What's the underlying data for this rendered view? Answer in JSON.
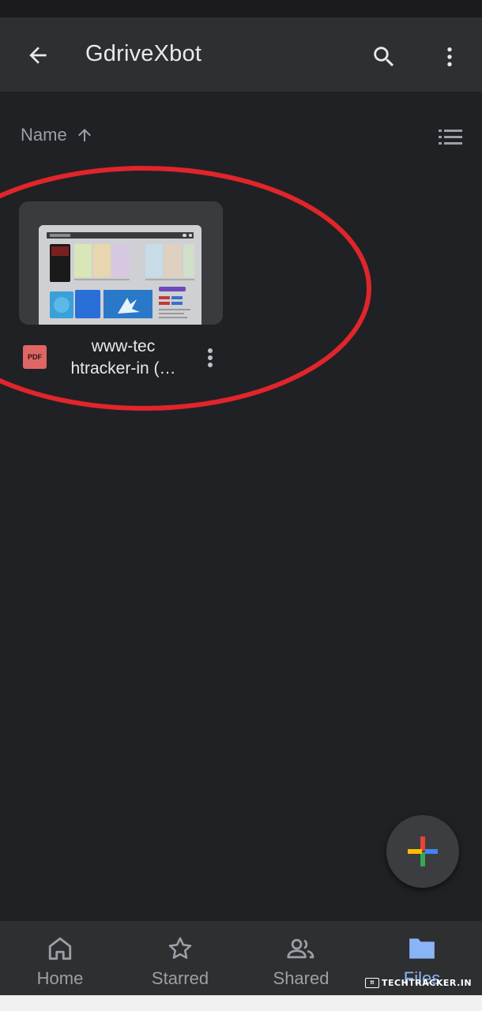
{
  "app_bar": {
    "title": "GdriveXbot",
    "back_icon": "arrow-left-icon",
    "search_icon": "search-icon",
    "more_icon": "more-vert-icon"
  },
  "sort": {
    "label": "Name",
    "direction_icon": "arrow-up-icon",
    "view_icon": "list-view-icon"
  },
  "files": [
    {
      "name": "www-tec htracker-in (…",
      "type_badge": "PDF",
      "type_icon": "pdf-icon"
    }
  ],
  "fab": {
    "icon": "plus-icon"
  },
  "bottom_nav": {
    "items": [
      {
        "label": "Home",
        "icon": "home-icon",
        "active": false
      },
      {
        "label": "Starred",
        "icon": "star-icon",
        "active": false
      },
      {
        "label": "Shared",
        "icon": "shared-people-icon",
        "active": false
      },
      {
        "label": "Files",
        "icon": "folder-icon",
        "active": true
      }
    ]
  },
  "watermark": {
    "badge": "tt",
    "text": "TECHTRACKER.IN"
  },
  "colors": {
    "background": "#202124",
    "app_bar": "#2e2f31",
    "text_primary": "#e8eaed",
    "text_secondary": "#9aa0a6",
    "active": "#8ab4f8",
    "pdf": "#e06666",
    "annotation": "#e0252b"
  }
}
